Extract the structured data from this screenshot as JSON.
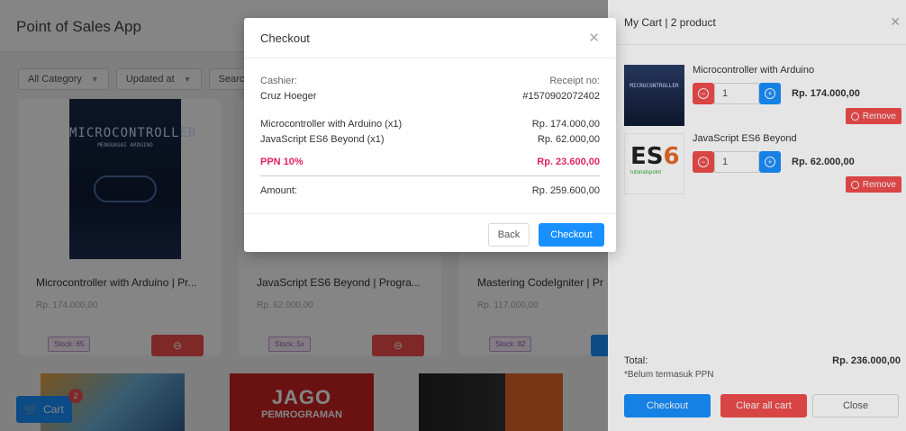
{
  "app": {
    "title": "Point of Sales App",
    "filters": [
      "All Category",
      "Updated at",
      "Search"
    ],
    "products": [
      {
        "name": "Microcontroller with Arduino | Pr...",
        "price": "Rp. 174.000,00",
        "stock": "Stock: 65",
        "cover_text": "MICROCONTROLLER",
        "cover_sub": "MENGUASAI ARDUINO"
      },
      {
        "name": "JavaScript ES6 Beyond | Progra...",
        "price": "Rp. 62.000,00",
        "stock": "Stock: 5x"
      },
      {
        "name": "Mastering CodeIgniter | Pr",
        "price": "Rp. 117.000,00",
        "stock": "Stock: 82"
      }
    ],
    "second_row_cover": {
      "line1": "JAGO",
      "line2": "PEMROGRAMAN"
    },
    "cart_button": "Cart",
    "cart_badge": "2"
  },
  "cart": {
    "title": "My Cart | 2 product",
    "items": [
      {
        "name": "Microcontroller with Arduino",
        "qty": "1",
        "price": "Rp. 174.000,00",
        "remove": "Remove",
        "thumb": "MICROCONTROLLER"
      },
      {
        "name": "JavaScript ES6 Beyond",
        "qty": "1",
        "price": "Rp. 62.000,00",
        "remove": "Remove",
        "thumb_a": "ES",
        "thumb_b": "6",
        "thumb_c": "tutorialspoint"
      }
    ],
    "total_label": "Total:",
    "total_value": "Rp. 236.000,00",
    "note": "*Belum termasuk PPN",
    "buttons": {
      "checkout": "Checkout",
      "clear": "Clear all cart",
      "close": "Close"
    }
  },
  "modal": {
    "title": "Checkout",
    "cashier_label": "Cashier:",
    "cashier_name": "Cruz Hoeger",
    "receipt_label": "Receipt no:",
    "receipt_no": "#1570902072402",
    "lines": [
      {
        "label": "Microcontroller with Arduino  (x1)",
        "value": "Rp. 174.000,00"
      },
      {
        "label": "JavaScript ES6 Beyond  (x1)",
        "value": "Rp. 62.000,00"
      }
    ],
    "tax_label": "PPN 10%",
    "tax_value": "Rp. 23.600,00",
    "amount_label": "Amount:",
    "amount_value": "Rp. 259.600,00",
    "back": "Back",
    "checkout": "Checkout"
  },
  "colors": {
    "primary": "#1890ff",
    "danger": "#f24d4d",
    "tax": "#e0245e"
  }
}
